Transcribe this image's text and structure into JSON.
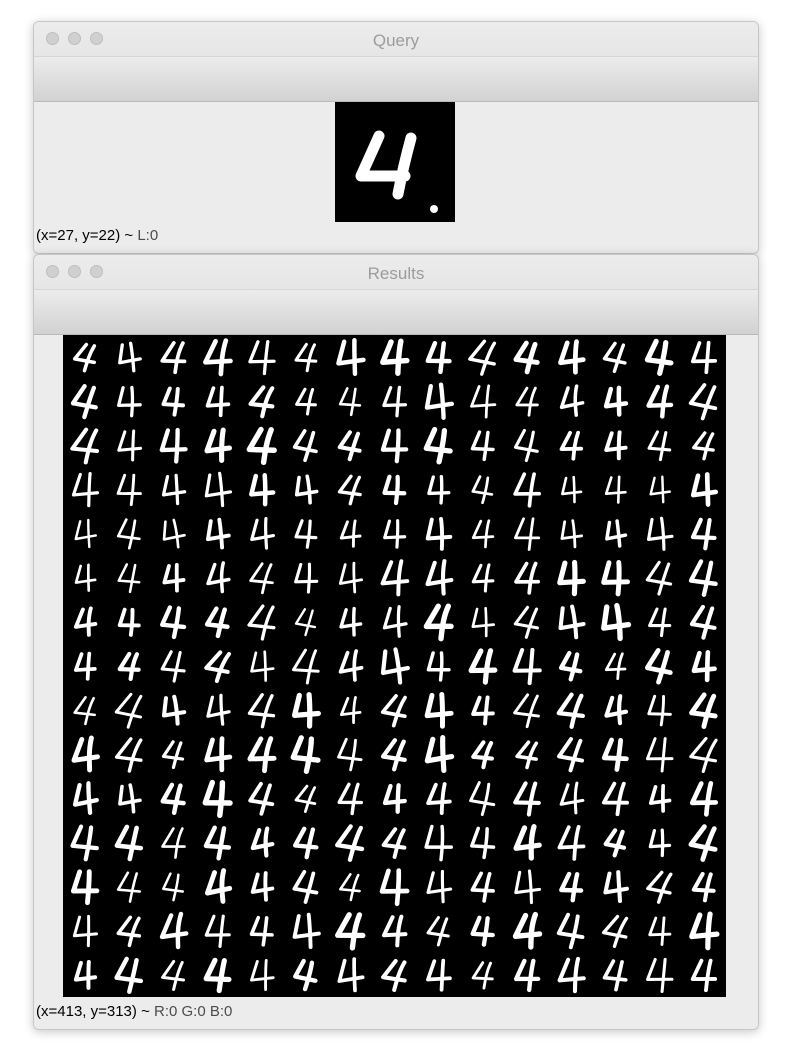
{
  "query_window": {
    "title": "Query",
    "status_coords": "(x=27, y=22) ~ ",
    "status_value": "L:0",
    "image": {
      "description_icon": "digit-4-thumbnail",
      "digit": "4"
    }
  },
  "results_window": {
    "title": "Results",
    "status_coords": "(x=413, y=313) ~ ",
    "status_value": "R:0 G:0 B:0",
    "grid": {
      "rows": 15,
      "cols": 15,
      "digit": "4"
    }
  }
}
